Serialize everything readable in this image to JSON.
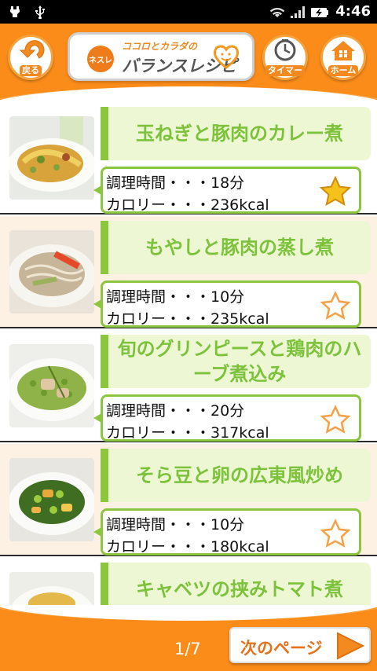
{
  "status_bar": {
    "time": "4:46",
    "icons": [
      "usb-icon",
      "wifi-icon",
      "signal-icon",
      "battery-charging-icon"
    ]
  },
  "header": {
    "back_label": "戻る",
    "logo_brand": "ネスレ",
    "logo_tagline": "ココロとカラダの",
    "logo_title": "バランスレシピ",
    "timer_label": "タイマー",
    "home_label": "ホーム",
    "colors": {
      "orange": "#fb8c1a",
      "green": "#8cc63e"
    }
  },
  "recipes": [
    {
      "title": "玉ねぎと豚肉のカレー煮",
      "time": "調理時間・・・18分",
      "calories": "カロリー・・・236kcal",
      "favorite": true
    },
    {
      "title": "もやしと豚肉の蒸し煮",
      "time": "調理時間・・・10分",
      "calories": "カロリー・・・235kcal",
      "favorite": false
    },
    {
      "title": "旬のグリンピースと鶏肉のハーブ煮込み",
      "time": "調理時間・・・20分",
      "calories": "カロリー・・・317kcal",
      "favorite": false
    },
    {
      "title": "そら豆と卵の広東風炒め",
      "time": "調理時間・・・10分",
      "calories": "カロリー・・・180kcal",
      "favorite": false
    },
    {
      "title": "キャベツの挟みトマト煮",
      "time": "",
      "calories": "",
      "favorite": false
    }
  ],
  "footer": {
    "page": "1/7",
    "next_label": "次のページ"
  }
}
